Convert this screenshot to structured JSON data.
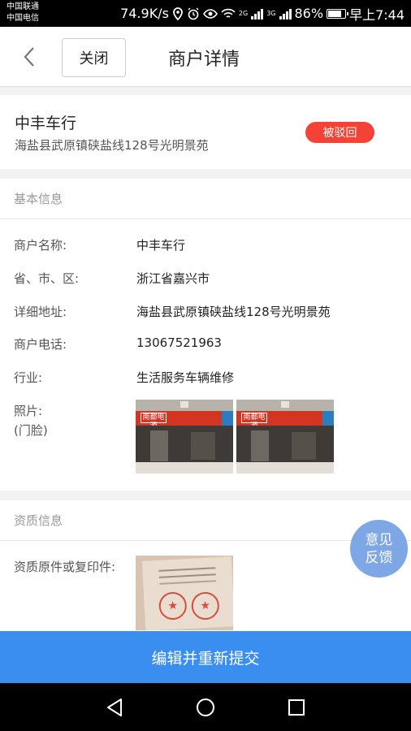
{
  "status_bar": {
    "carrier1": "中国联通",
    "carrier2": "中国电信",
    "speed": "74.9K/s",
    "net1": "2G",
    "net2": "3G",
    "battery": "86%",
    "time": "早上7:44"
  },
  "header": {
    "close_label": "关闭",
    "title": "商户详情"
  },
  "merchant": {
    "name": "中丰车行",
    "address": "海盐县武原镇硖盐线128号光明景苑",
    "status": "被驳回"
  },
  "basic_info": {
    "heading": "基本信息",
    "rows": [
      {
        "label": "商户名称:",
        "value": "中丰车行"
      },
      {
        "label": "省、市、区:",
        "value": "浙江省嘉兴市"
      },
      {
        "label": "详细地址:",
        "value": "海盐县武原镇硖盐线128号光明景苑"
      },
      {
        "label": "商户电话:",
        "value": "13067521963"
      },
      {
        "label": "行业:",
        "value": "生活服务车辆维修"
      }
    ],
    "photo_label": "照片:",
    "photo_sublabel": "(门脸)",
    "store_sign_text": "南都电源"
  },
  "qualification": {
    "heading": "资质信息",
    "doc_label": "资质原件或复印件:"
  },
  "feedback": {
    "line1": "意见",
    "line2": "反馈"
  },
  "submit_label": "编辑并重新提交",
  "colors": {
    "accent": "#3a8ef0",
    "badge": "#f44336",
    "feedback": "#7ea7e6"
  }
}
